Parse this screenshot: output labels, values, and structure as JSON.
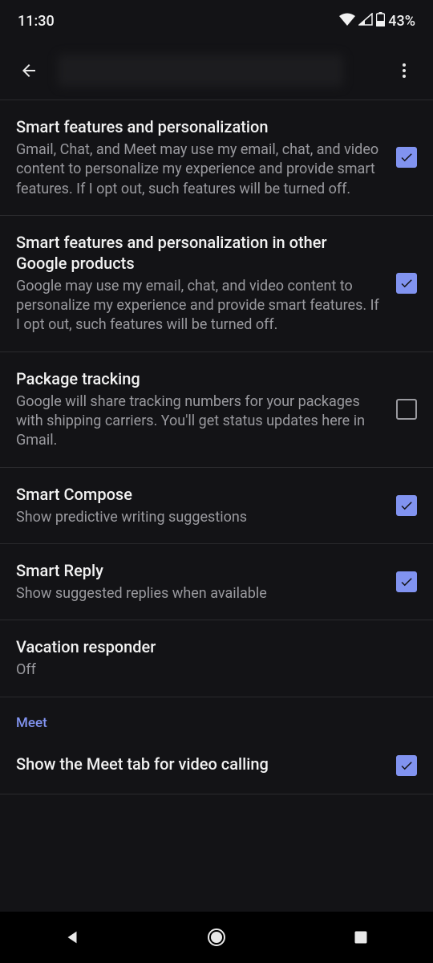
{
  "status": {
    "time": "11:30",
    "battery": "43%"
  },
  "settings": [
    {
      "title": "Smart features and personalization",
      "desc": "Gmail, Chat, and Meet may use my email, chat, and video content to personalize my experience and provide smart features. If I opt out, such features will be turned off.",
      "checked": true
    },
    {
      "title": "Smart features and personalization in other Google products",
      "desc": "Google may use my email, chat, and video content to personalize my experience and provide smart features. If I opt out, such features will be turned off.",
      "checked": true
    },
    {
      "title": "Package tracking",
      "desc": "Google will share tracking numbers for your packages with shipping carriers. You'll get status updates here in Gmail.",
      "checked": false
    },
    {
      "title": "Smart Compose",
      "desc": "Show predictive writing suggestions",
      "checked": true
    },
    {
      "title": "Smart Reply",
      "desc": "Show suggested replies when available",
      "checked": true
    },
    {
      "title": "Vacation responder",
      "desc": "Off",
      "checked": null
    }
  ],
  "section_meet": "Meet",
  "meet_item": {
    "title": "Show the Meet tab for video calling",
    "checked": true
  }
}
